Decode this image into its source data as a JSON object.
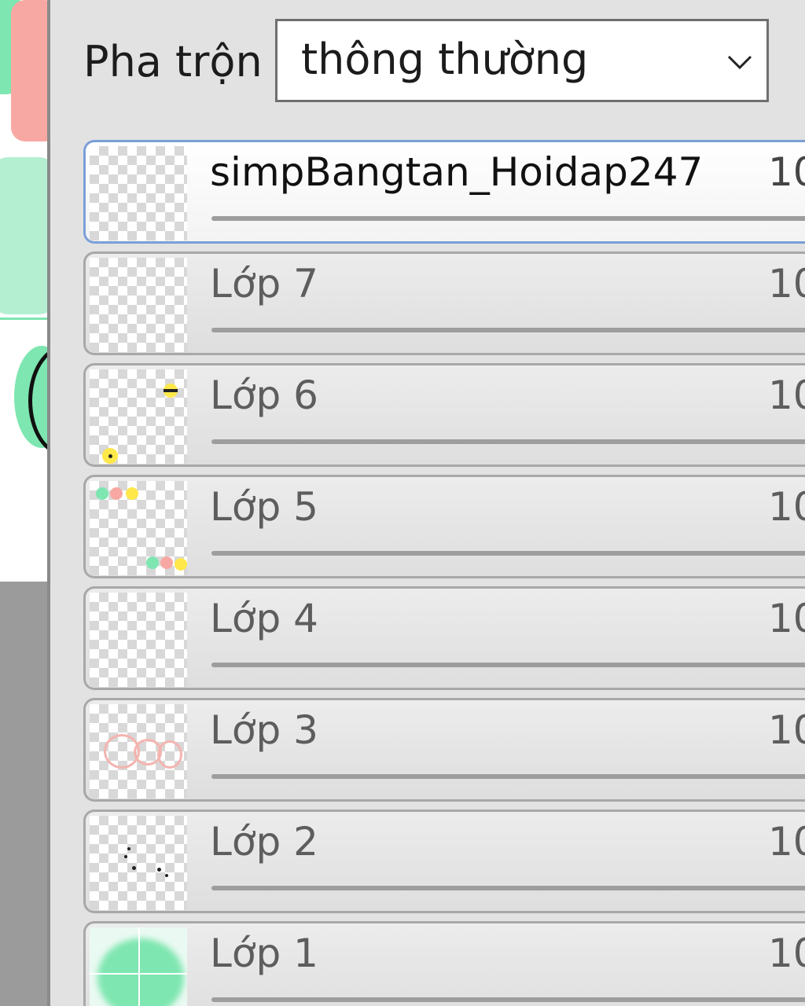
{
  "blend": {
    "label": "Pha trộn",
    "value": "thông thường"
  },
  "layers": [
    {
      "name": "simpBangtan_Hoidap247",
      "opacity": "10",
      "selected": true
    },
    {
      "name": "Lớp 7",
      "opacity": "10",
      "selected": false
    },
    {
      "name": "Lớp 6",
      "opacity": "10",
      "selected": false
    },
    {
      "name": "Lớp 5",
      "opacity": "10",
      "selected": false
    },
    {
      "name": "Lớp 4",
      "opacity": "10",
      "selected": false
    },
    {
      "name": "Lớp 3",
      "opacity": "10",
      "selected": false
    },
    {
      "name": "Lớp 2",
      "opacity": "10",
      "selected": false
    },
    {
      "name": "Lớp 1",
      "opacity": "10",
      "selected": false
    }
  ],
  "colors": {
    "panel": "#e2e2e2",
    "selected_border": "#7a9fd8",
    "mint": "#7ee6b0",
    "pink": "#f8a8a2"
  },
  "icons": {
    "dropdown": "chevron-down-icon"
  }
}
